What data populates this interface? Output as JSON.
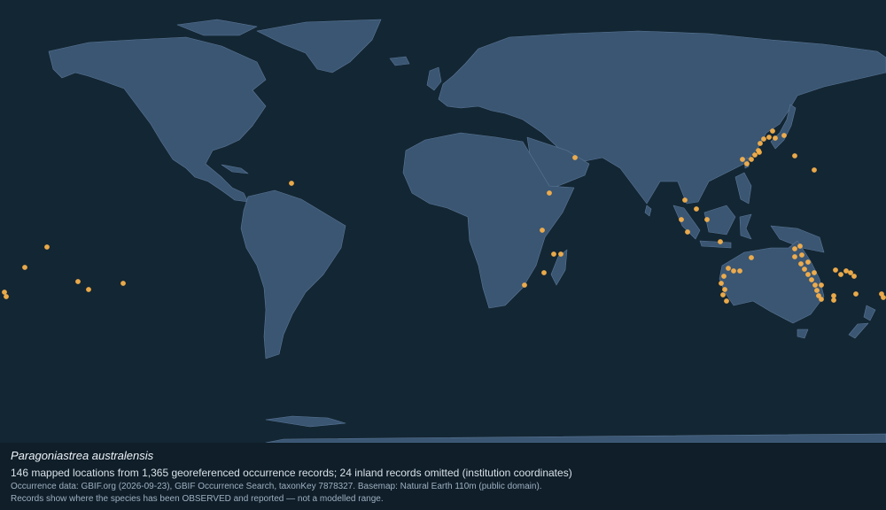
{
  "map": {
    "occurrence_color": "#f6b04b",
    "land_color": "#3a5673",
    "ocean_color": "#132633"
  },
  "caption": {
    "species": "Paragoniastrea australensis",
    "summary": "146 mapped locations from 1,365 georeferenced occurrence records; 24 inland records omitted (institution coordinates)",
    "source": "Occurrence data: GBIF.org (2026-09-23), GBIF Occurrence Search, taxonKey 7878327. Basemap: Natural Earth 110m (public domain).",
    "disclaimer": "Records show where the species has been OBSERVED and reported — not a modelled range."
  }
}
